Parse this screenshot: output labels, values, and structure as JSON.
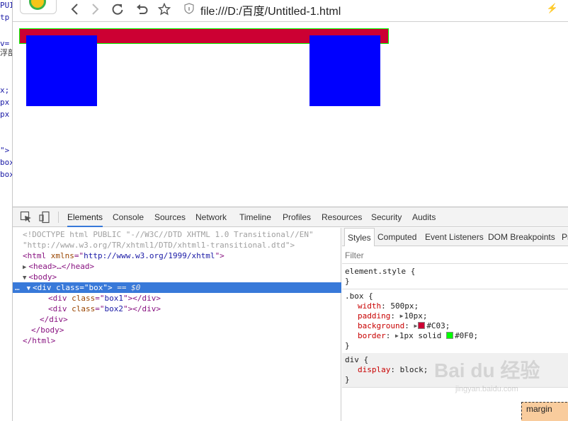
{
  "editor_strip": {
    "lines": [
      "PUI",
      "tp",
      "",
      "v=",
      "浮部",
      "",
      "",
      "x;",
      "px",
      "px",
      "",
      "",
      "\">",
      "box",
      "box"
    ]
  },
  "browser": {
    "url": "file:///D:/百度/Untitled-1.html",
    "nav_icons": [
      "back-icon",
      "forward-icon",
      "reload-icon",
      "undo-icon",
      "star-icon"
    ]
  },
  "viewport": {
    "box_color": "#CC0033",
    "box_border_color": "#00FF00",
    "child_color": "#0000FF"
  },
  "devtools": {
    "tabs": [
      "Elements",
      "Console",
      "Sources",
      "Network",
      "Timeline",
      "Profiles",
      "Resources",
      "Security",
      "Audits"
    ],
    "active_tab": "Elements",
    "dom_lines": {
      "doctype1": "<!DOCTYPE html PUBLIC \"-//W3C//DTD XHTML 1.0 Transitional//EN\"",
      "doctype2": "\"http://www.w3.org/TR/xhtml1/DTD/xhtml1-transitional.dtd\">",
      "html_open_tag": "<html ",
      "html_attr": "xmlns",
      "html_eq": "=\"",
      "html_val": "http://www.w3.org/1999/xhtml",
      "html_close": "\">",
      "head": "<head>…</head>",
      "body_open": "<body>",
      "div_box_tag": "<div ",
      "div_box_attr": "class",
      "div_box_eq": "=\"",
      "div_box_val": "box",
      "div_box_close": "\">",
      "div_box_marker": " == $0",
      "dots": "…",
      "box1_tag": "<div ",
      "box1_attr": "class",
      "box1_eq": "=\"",
      "box1_val": "box1",
      "box1_close": "\"></div>",
      "box2_tag": "<div ",
      "box2_attr": "class",
      "box2_eq": "=\"",
      "box2_val": "box2",
      "box2_close": "\"></div>",
      "div_close": "</div>",
      "body_close": "</body>",
      "html_close_tag": "</html>"
    },
    "styles_tabs": [
      "Styles",
      "Computed",
      "Event Listeners",
      "DOM Breakpoints",
      "Pr"
    ],
    "filter_placeholder": "Filter",
    "rules": {
      "element_style_open": "element.style {",
      "element_style_close": "}",
      "box_selector": ".box {",
      "box_width_name": "width",
      "box_width_val": ": 500px;",
      "box_padding_name": "padding",
      "box_padding_val": "10px;",
      "box_background_name": "background",
      "box_background_val": "#C03;",
      "box_border_name": "border",
      "box_border_val1": "1px solid ",
      "box_border_val2": "#0F0;",
      "box_close": "}",
      "div_selector": "div {",
      "div_display_name": "display",
      "div_display_val": ": block;",
      "div_close": "}"
    },
    "swatch_background": "#CC0033",
    "swatch_border": "#00FF00",
    "box_model_label": "margin"
  },
  "watermark": {
    "main": "Bai du 经验",
    "sub": "jingyan.baidu.com"
  }
}
